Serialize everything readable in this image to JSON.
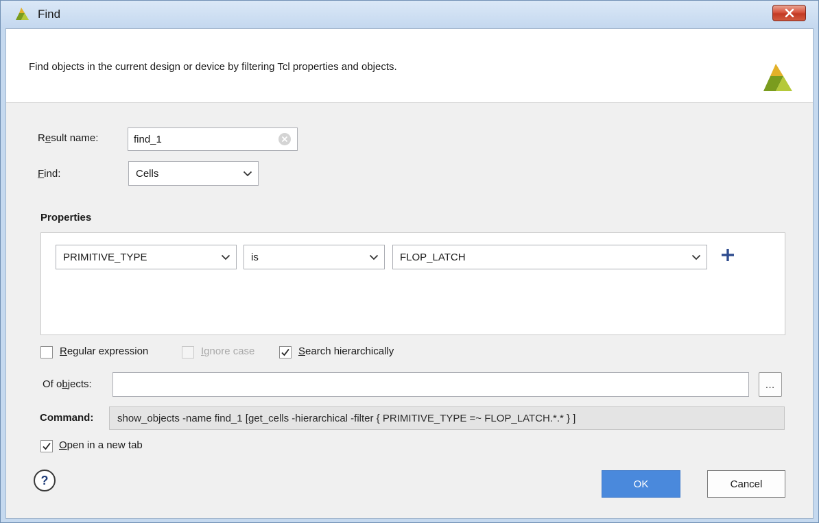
{
  "window": {
    "title": "Find",
    "close_icon": "close-icon",
    "logo_icon": "vivado-logo-icon"
  },
  "header": {
    "description": "Find objects in the current design or device by filtering Tcl properties and objects."
  },
  "form": {
    "result_name_label_pre": "R",
    "result_name_label_u": "e",
    "result_name_label_post": "sult name:",
    "result_name_value": "find_1",
    "find_label_u": "F",
    "find_label_post": "ind:",
    "find_value": "Cells"
  },
  "properties": {
    "heading": "Properties",
    "property": "PRIMITIVE_TYPE",
    "operator": "is",
    "value": "FLOP_LATCH"
  },
  "options": {
    "regular_expression_u": "R",
    "regular_expression_post": "egular expression",
    "regular_expression_checked": false,
    "ignore_case_u": "I",
    "ignore_case_post": "gnore case",
    "ignore_case_checked": false,
    "ignore_case_disabled": true,
    "search_hier_u": "S",
    "search_hier_post": "earch hierarchically",
    "search_hier_checked": true
  },
  "of_objects": {
    "label_pre": "Of o",
    "label_u": "b",
    "label_post": "jects:",
    "value": "",
    "browse_label": "..."
  },
  "command": {
    "label": "Command:",
    "text": "show_objects -name find_1 [get_cells -hierarchical -filter { PRIMITIVE_TYPE =~ FLOP_LATCH.*.* } ]"
  },
  "open_new_tab": {
    "label_u": "O",
    "label_post": "pen in a new tab",
    "checked": true
  },
  "footer": {
    "help_label": "?",
    "ok_label": "OK",
    "cancel_label": "Cancel"
  },
  "colors": {
    "accent": "#4a89dc",
    "plus": "#2f4d8f",
    "close": "#c23a24"
  }
}
